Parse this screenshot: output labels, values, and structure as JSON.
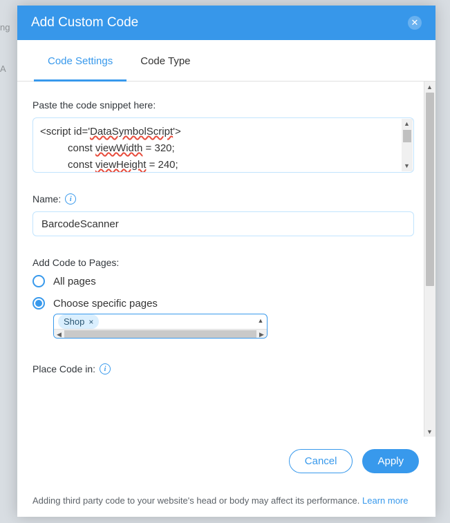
{
  "header": {
    "title": "Add Custom Code"
  },
  "tabs": {
    "active": "Code Settings",
    "items": [
      "Code Settings",
      "Code Type"
    ]
  },
  "code_section": {
    "label": "Paste the code snippet here:",
    "line1_prefix": "<script id='",
    "line1_squiggle": "DataSymbolScript",
    "line1_suffix": "'>",
    "line2_kw": "const",
    "line2_var": "viewWidth",
    "line2_rest": " = 320;",
    "line3_kw": "const",
    "line3_var": "viewHeight",
    "line3_rest": " = 240;"
  },
  "name_section": {
    "label": "Name:",
    "value": "BarcodeScanner"
  },
  "pages_section": {
    "label": "Add Code to Pages:",
    "option_all": "All pages",
    "option_specific": "Choose specific pages",
    "selected": "specific",
    "tag": "Shop"
  },
  "place_section": {
    "label": "Place Code in:"
  },
  "footer": {
    "cancel": "Cancel",
    "apply": "Apply",
    "note_text": "Adding third party code to your website's head or body may affect its performance. ",
    "note_link": "Learn more"
  }
}
